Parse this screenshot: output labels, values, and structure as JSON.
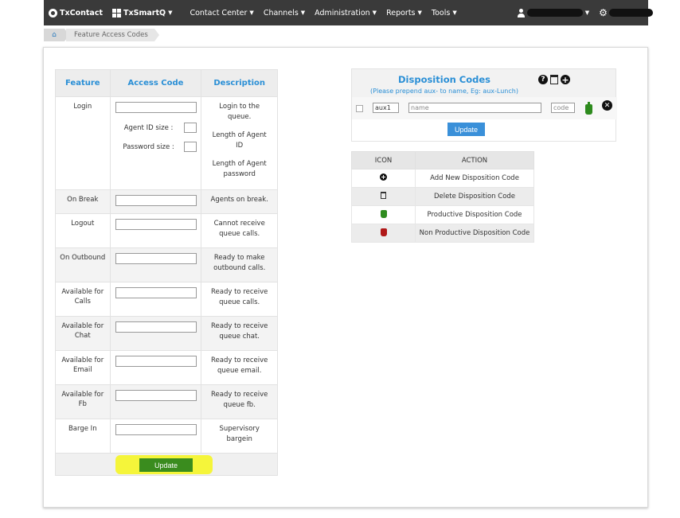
{
  "nav": {
    "brand": "TxContact",
    "product": "TxSmartQ",
    "items": [
      "Contact Center",
      "Channels",
      "Administration",
      "Reports",
      "Tools"
    ]
  },
  "breadcrumb": {
    "current": "Feature Access Codes"
  },
  "features": {
    "headers": {
      "feature": "Feature",
      "code": "Access Code",
      "description": "Description"
    },
    "login": {
      "name": "Login",
      "agent_id_label": "Agent ID size :",
      "password_label": "Password size :",
      "desc1": "Login to the queue.",
      "desc2": "Length of Agent ID",
      "desc3": "Length of Agent password"
    },
    "rows": [
      {
        "name": "On Break",
        "desc": "Agents on break."
      },
      {
        "name": "Logout",
        "desc": "Cannot receive queue calls."
      },
      {
        "name": "On Outbound",
        "desc": "Ready to make outbound calls."
      },
      {
        "name": "Available for Calls",
        "desc": "Ready to receive queue calls."
      },
      {
        "name": "Available for Chat",
        "desc": "Ready to receive queue chat."
      },
      {
        "name": "Available for Email",
        "desc": "Ready to receive queue email."
      },
      {
        "name": "Available for Fb",
        "desc": "Ready to receive queue fb."
      },
      {
        "name": "Barge In",
        "desc": "Supervisory bargein"
      }
    ],
    "update_label": "Update"
  },
  "disposition": {
    "title": "Disposition Codes",
    "subtitle": "(Please prepend aux- to name, Eg: aux-Lunch)",
    "row": {
      "key": "aux1",
      "name_placeholder": "name",
      "code_placeholder": "code"
    },
    "update_label": "Update"
  },
  "legend": {
    "headers": {
      "icon": "ICON",
      "action": "ACTION"
    },
    "rows": [
      {
        "icon": "add-icon",
        "action": "Add New Disposition Code"
      },
      {
        "icon": "trash-icon",
        "action": "Delete Disposition Code"
      },
      {
        "icon": "green-bag-icon",
        "action": "Productive Disposition Code"
      },
      {
        "icon": "red-bag-icon",
        "action": "Non Productive Disposition Code"
      }
    ]
  },
  "colors": {
    "accent": "#2a8fd6",
    "nav_bg": "#3a3a3a",
    "update_green": "#3a8c1e",
    "update_blue": "#3a90d9",
    "highlight": "#f5f53a"
  }
}
